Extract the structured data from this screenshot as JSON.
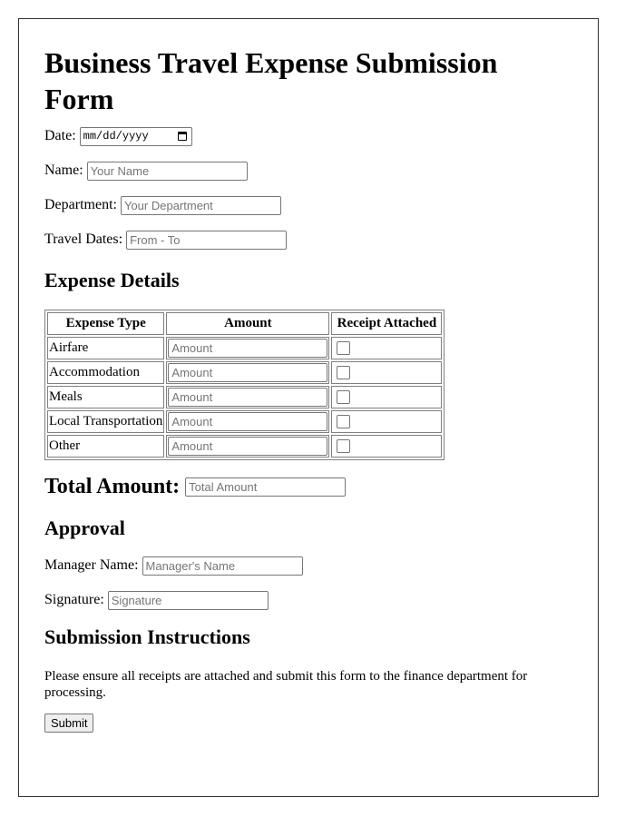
{
  "form": {
    "title": "Business Travel Expense Submission Form",
    "date": {
      "label": "Date:",
      "placeholder": "mm/dd/yyyy"
    },
    "name": {
      "label": "Name:",
      "placeholder": "Your Name"
    },
    "department": {
      "label": "Department:",
      "placeholder": "Your Department"
    },
    "travel_dates": {
      "label": "Travel Dates:",
      "placeholder": "From - To"
    }
  },
  "expense_details": {
    "heading": "Expense Details",
    "columns": [
      "Expense Type",
      "Amount",
      "Receipt Attached"
    ],
    "rows": [
      {
        "type": "Airfare",
        "amount_placeholder": "Amount",
        "receipt_checked": false
      },
      {
        "type": "Accommodation",
        "amount_placeholder": "Amount",
        "receipt_checked": false
      },
      {
        "type": "Meals",
        "amount_placeholder": "Amount",
        "receipt_checked": false
      },
      {
        "type": "Local Transportation",
        "amount_placeholder": "Amount",
        "receipt_checked": false
      },
      {
        "type": "Other",
        "amount_placeholder": "Amount",
        "receipt_checked": false
      }
    ]
  },
  "total": {
    "label": "Total Amount:",
    "placeholder": "Total Amount"
  },
  "approval": {
    "heading": "Approval",
    "manager": {
      "label": "Manager Name:",
      "placeholder": "Manager's Name"
    },
    "signature": {
      "label": "Signature:",
      "placeholder": "Signature"
    }
  },
  "instructions": {
    "heading": "Submission Instructions",
    "text": "Please ensure all receipts are attached and submit this form to the finance department for processing."
  },
  "submit_label": "Submit"
}
